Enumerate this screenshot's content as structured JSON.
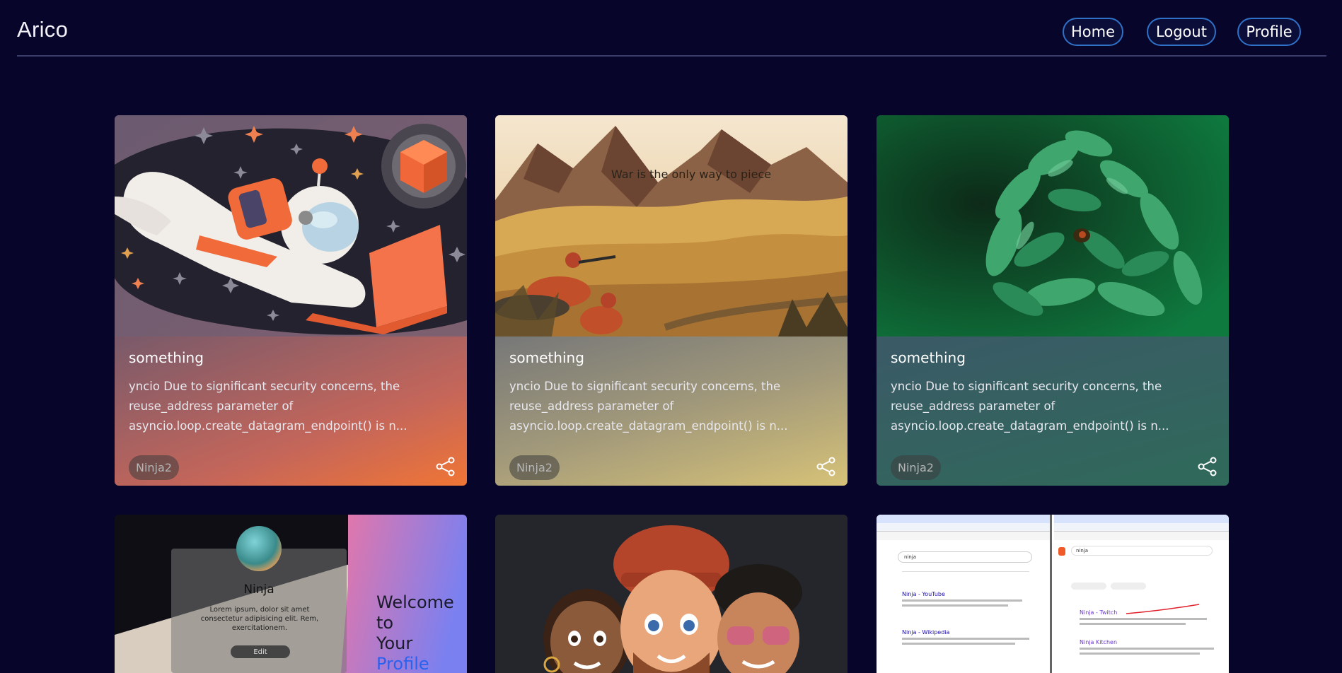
{
  "app": {
    "brand": "Arico"
  },
  "nav": {
    "home": "Home",
    "logout": "Logout",
    "profile": "Profile"
  },
  "cards": [
    {
      "title": "something",
      "description": "yncio Due to significant security concerns, the reuse_address parameter of asyncio.loop.create_datagram_endpoint() is n...",
      "author": "Ninja2",
      "image_icon": "astronaut-illustration",
      "theme_color": "#e8703f"
    },
    {
      "title": "something",
      "description": "yncio Due to significant security concerns, the reuse_address parameter of asyncio.loop.create_datagram_endpoint() is n...",
      "author": "Ninja2",
      "image_icon": "mountain-landscape",
      "image_caption": "War is the only way to piece",
      "theme_color": "#c9a55a"
    },
    {
      "title": "something",
      "description": "yncio Due to significant security concerns, the reuse_address parameter of asyncio.loop.create_datagram_endpoint() is n...",
      "author": "Ninja2",
      "image_icon": "leaf-creature",
      "theme_color": "#2e6a55"
    }
  ],
  "profile_preview": {
    "name": "Ninja",
    "bio": "Lorem ipsum, dolor sit amet consectetur adipisicing elit. Rem, exercitationem.",
    "edit_label": "Edit",
    "welcome_line1": "Welcome",
    "welcome_line2": "to",
    "welcome_line3": "Your",
    "welcome_accent": "Profile"
  },
  "search_preview": {
    "left_query": "ninja",
    "left_result_1": "Ninja - YouTube",
    "left_result_2": "Ninja - Wikipedia",
    "right_query": "ninja",
    "right_result_1": "Ninja - Twitch",
    "right_result_2": "Ninja Kitchen"
  },
  "icons": {
    "share": "share-icon"
  },
  "colors": {
    "background": "#07052a",
    "nav_border": "#2f71c7"
  }
}
